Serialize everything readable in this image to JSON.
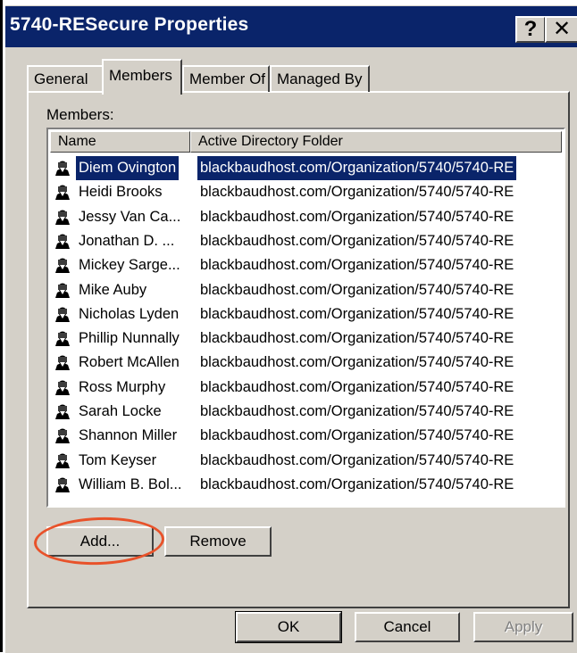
{
  "window": {
    "title": "5740-RESecure Properties"
  },
  "title_buttons": {
    "help": "?",
    "close": "✕"
  },
  "tabs": [
    {
      "label": "General",
      "active": false
    },
    {
      "label": "Members",
      "active": true
    },
    {
      "label": "Member Of",
      "active": false
    },
    {
      "label": "Managed By",
      "active": false
    }
  ],
  "members_label": "Members:",
  "columns": {
    "name": "Name",
    "folder": "Active Directory Folder"
  },
  "rows": [
    {
      "name": "Diem Ovington",
      "folder": "blackbaudhost.com/Organization/5740/5740-RE",
      "selected": true
    },
    {
      "name": "Heidi Brooks",
      "folder": "blackbaudhost.com/Organization/5740/5740-RE"
    },
    {
      "name": "Jessy Van Ca...",
      "folder": "blackbaudhost.com/Organization/5740/5740-RE"
    },
    {
      "name": "Jonathan D. ...",
      "folder": "blackbaudhost.com/Organization/5740/5740-RE"
    },
    {
      "name": "Mickey Sarge...",
      "folder": "blackbaudhost.com/Organization/5740/5740-RE"
    },
    {
      "name": "Mike Auby",
      "folder": "blackbaudhost.com/Organization/5740/5740-RE"
    },
    {
      "name": "Nicholas Lyden",
      "folder": "blackbaudhost.com/Organization/5740/5740-RE"
    },
    {
      "name": "Phillip Nunnally",
      "folder": "blackbaudhost.com/Organization/5740/5740-RE"
    },
    {
      "name": "Robert McAllen",
      "folder": "blackbaudhost.com/Organization/5740/5740-RE"
    },
    {
      "name": "Ross Murphy",
      "folder": "blackbaudhost.com/Organization/5740/5740-RE"
    },
    {
      "name": "Sarah Locke",
      "folder": "blackbaudhost.com/Organization/5740/5740-RE"
    },
    {
      "name": "Shannon Miller",
      "folder": "blackbaudhost.com/Organization/5740/5740-RE"
    },
    {
      "name": "Tom Keyser",
      "folder": "blackbaudhost.com/Organization/5740/5740-RE"
    },
    {
      "name": "William B. Bol...",
      "folder": "blackbaudhost.com/Organization/5740/5740-RE"
    }
  ],
  "buttons": {
    "add": "Add...",
    "remove": "Remove",
    "ok": "OK",
    "cancel": "Cancel",
    "apply": "Apply"
  },
  "colors": {
    "titlebar": "#0a246a",
    "face": "#d4d0c8",
    "selection": "#0a246a",
    "highlight_ring": "#e8522a"
  },
  "icons": {
    "member": "user-icon"
  }
}
